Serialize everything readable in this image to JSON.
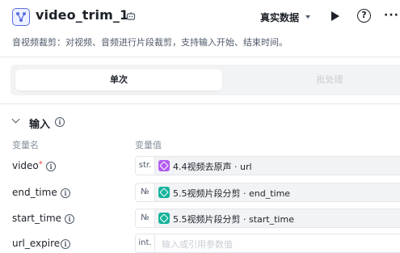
{
  "header": {
    "title": "video_trim_1",
    "data_mode": "真实数据",
    "icons": [
      "workflow-node-icon",
      "robot-icon",
      "caret-down-icon",
      "play-icon",
      "help-icon",
      "more-icon"
    ]
  },
  "description": "音视频裁剪：对视频、音频进行片段裁剪，支持输入开始、结束时间。",
  "tabs": [
    {
      "label": "单次",
      "active": true
    },
    {
      "label": "批处理",
      "active": false
    }
  ],
  "input_section": {
    "title": "输入",
    "col_name": "变量名",
    "col_value": "变量值",
    "rows": [
      {
        "name": "video",
        "required": "*",
        "type": "str.",
        "source_color": "#b35cf0",
        "ref": "4.4视频去原声 · url"
      },
      {
        "name": "end_time",
        "required": "",
        "type": "№",
        "source_color": "#16b39b",
        "ref": "5.5视频片段分剪 · end_time"
      },
      {
        "name": "start_time",
        "required": "",
        "type": "№",
        "source_color": "#16b39b",
        "ref": "5.5视频片段分剪 · start_time"
      },
      {
        "name": "url_expire",
        "required": "",
        "type": "int.",
        "placeholder": "输入或引用参数值"
      }
    ]
  },
  "colors": {
    "accent": "#5b6ee1",
    "required": "#f53f3f",
    "panel_bg": "#f2f3f5"
  }
}
